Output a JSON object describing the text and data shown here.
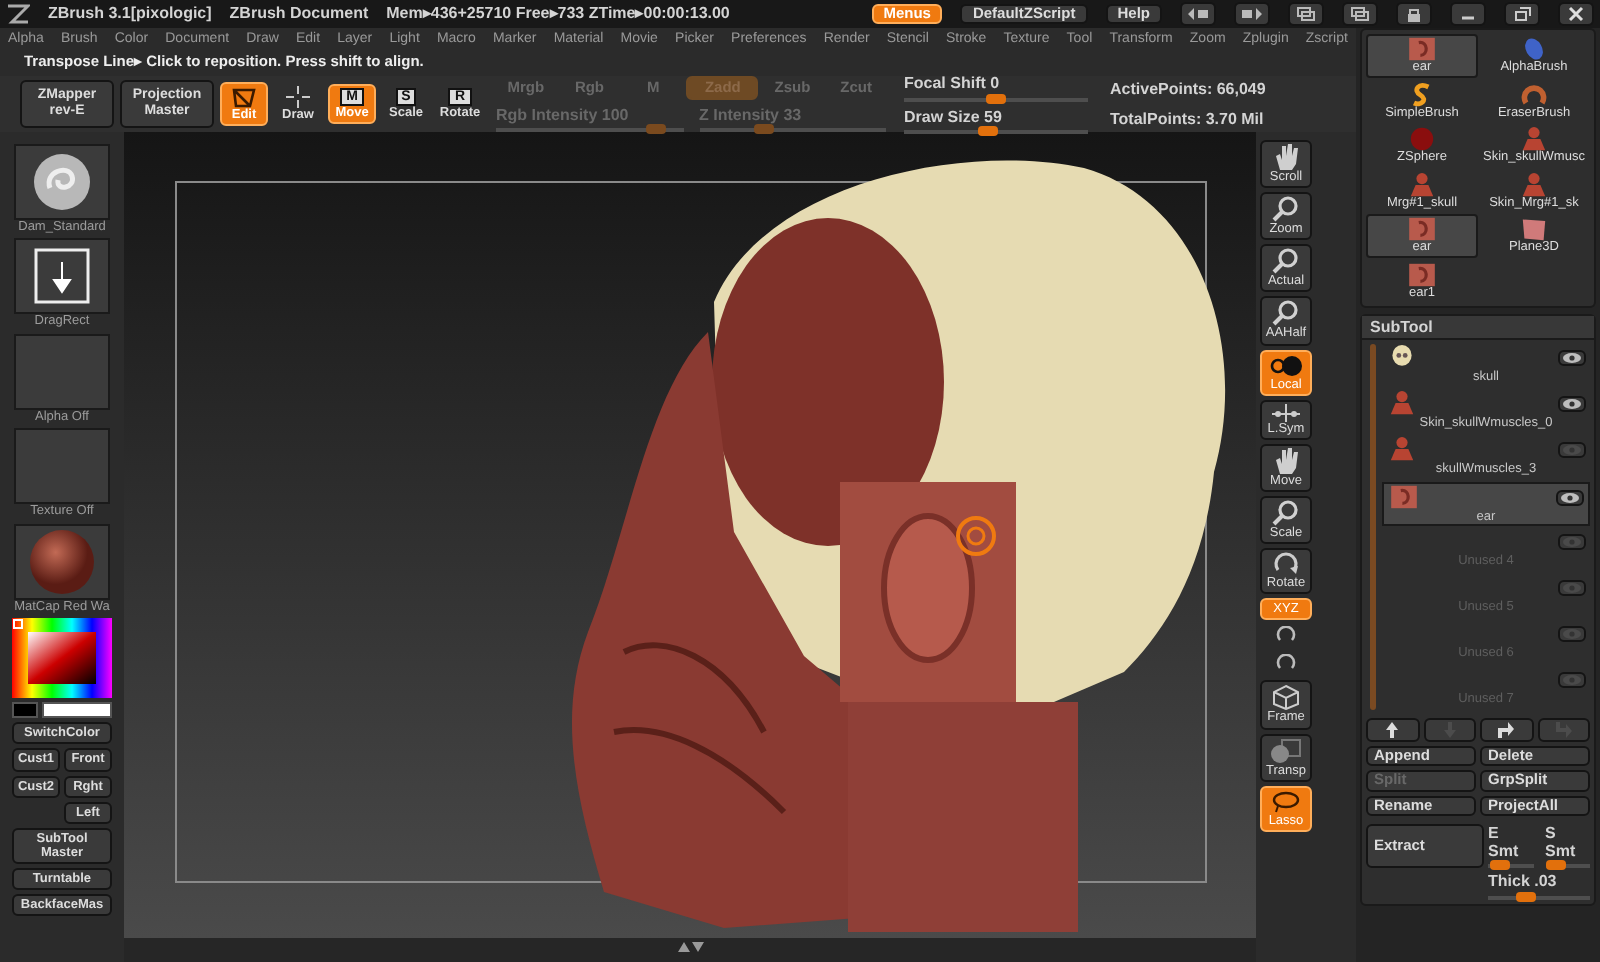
{
  "title_bar": {
    "app": "ZBrush 3.1[pixologic]",
    "document": "ZBrush Document",
    "stats": "Mem▸436+25710 Free▸733 ZTime▸00:00:13.00",
    "buttons": [
      {
        "label": "Menus",
        "selected": true
      },
      {
        "label": "DefaultZScript",
        "selected": false
      },
      {
        "label": "Help",
        "selected": false
      }
    ]
  },
  "menu_bar": [
    "Alpha",
    "Brush",
    "Color",
    "Document",
    "Draw",
    "Edit",
    "Layer",
    "Light",
    "Macro",
    "Marker",
    "Material",
    "Movie",
    "Picker",
    "Preferences",
    "Render",
    "Stencil",
    "Stroke",
    "Texture",
    "Tool",
    "Transform",
    "Zoom",
    "Zplugin",
    "Zscript"
  ],
  "notice": "Transpose Line▸ Click to reposition. Press shift to align.",
  "toolbar": {
    "buttons": [
      {
        "label": "ZMapper",
        "sublabel": "rev-E"
      },
      {
        "label": "Projection",
        "sublabel": "Master"
      }
    ],
    "tools": [
      {
        "kind": "edit",
        "label": "Edit",
        "on": true
      },
      {
        "kind": "draw",
        "label": "Draw",
        "on": false
      },
      {
        "kind": "move",
        "label": "Move",
        "letter": "M",
        "on": true
      },
      {
        "kind": "scale",
        "label": "Scale",
        "letter": "S",
        "on": false
      },
      {
        "kind": "rotate",
        "label": "Rotate",
        "letter": "R",
        "on": false
      }
    ],
    "channels": [
      {
        "label": "Mrgb",
        "on": false,
        "disabled": true
      },
      {
        "label": "Rgb",
        "on": false,
        "disabled": true
      },
      {
        "label": "M",
        "on": false,
        "disabled": true
      },
      {
        "label": "Zadd",
        "on": true,
        "disabled": true
      },
      {
        "label": "Zsub",
        "on": false,
        "disabled": true
      },
      {
        "label": "Zcut",
        "on": false,
        "disabled": true
      }
    ],
    "intensity_sliders": [
      {
        "label": "Rgb Intensity",
        "value": "100",
        "level": 0.9,
        "disabled": true
      },
      {
        "label": "Z Intensity",
        "value": "33",
        "level": 0.33,
        "disabled": true
      }
    ],
    "draw_sliders": [
      {
        "label": "Focal Shift",
        "value": "0",
        "level": 0.5
      },
      {
        "label": "Draw Size",
        "value": "59",
        "level": 0.45
      }
    ],
    "stats": [
      "ActivePoints: 66,049",
      "TotalPoints: 3.70 Mil"
    ]
  },
  "left_shelf": {
    "thumbs": [
      {
        "kind": "brush",
        "label": "Dam_Standard"
      },
      {
        "kind": "stroke",
        "label": "DragRect"
      },
      {
        "kind": "alpha",
        "label": "Alpha Off"
      },
      {
        "kind": "texture",
        "label": "Texture Off"
      },
      {
        "kind": "material",
        "label": "MatCap Red Wa"
      }
    ],
    "swatches": [
      {
        "color": "#000000"
      },
      {
        "color": "#ffffff"
      }
    ],
    "button_rows": [
      [
        "SwitchColor"
      ],
      [
        "Cust1",
        "Front"
      ],
      [
        "Cust2",
        "Rght"
      ],
      [
        "Left"
      ],
      [
        "SubTool Master"
      ],
      [
        "Turntable"
      ],
      [
        "BackfaceMas"
      ]
    ]
  },
  "right_shelf": [
    {
      "kind": "scroll",
      "label": "Scroll",
      "on": false
    },
    {
      "kind": "zoom",
      "label": "Zoom",
      "on": false
    },
    {
      "kind": "actual",
      "label": "Actual",
      "on": false
    },
    {
      "kind": "aahalf",
      "label": "AAHalf",
      "on": false
    },
    {
      "kind": "local",
      "label": "Local",
      "on": true
    },
    {
      "kind": "lsym",
      "label": "L.Sym",
      "on": false
    },
    {
      "kind": "move",
      "label": "Move",
      "on": false
    },
    {
      "kind": "scale",
      "label": "Scale",
      "on": false
    },
    {
      "kind": "rotate",
      "label": "Rotate",
      "on": false
    },
    {
      "kind": "xyz",
      "label": "XYZ",
      "on": true
    },
    {
      "kind": "rot-y"
    },
    {
      "kind": "rot-z"
    },
    {
      "kind": "frame",
      "label": "Frame",
      "on": false
    },
    {
      "kind": "transp",
      "label": "Transp",
      "on": false
    },
    {
      "kind": "lasso",
      "label": "Lasso",
      "on": true
    }
  ],
  "tool_palette": [
    {
      "kind": "ear",
      "label": "ear",
      "selected": true
    },
    {
      "kind": "alpha",
      "label": "AlphaBrush",
      "selected": false
    },
    {
      "kind": "simple",
      "label": "SimpleBrush",
      "selected": false
    },
    {
      "kind": "eraser",
      "label": "EraserBrush",
      "selected": false
    },
    {
      "kind": "zsphere",
      "label": "ZSphere",
      "selected": false
    },
    {
      "kind": "figure",
      "label": "Skin_skullWmusc",
      "selected": false
    },
    {
      "kind": "figure",
      "label": "Mrg#1_skull",
      "selected": false
    },
    {
      "kind": "figure",
      "label": "Skin_Mrg#1_sk",
      "selected": false
    },
    {
      "kind": "ear",
      "label": "ear",
      "selected": true
    },
    {
      "kind": "plane",
      "label": "Plane3D",
      "selected": false
    },
    {
      "kind": "ear",
      "label": "ear1",
      "selected": false
    }
  ],
  "subtool": {
    "title": "SubTool",
    "items": [
      {
        "kind": "skull",
        "label": "skull",
        "selected": false,
        "visible": true
      },
      {
        "kind": "figure",
        "label": "Skin_skullWmuscles_0",
        "selected": false,
        "visible": true
      },
      {
        "kind": "figure",
        "label": "skullWmuscles_3",
        "selected": false,
        "visible": false
      },
      {
        "kind": "ear",
        "label": "ear",
        "selected": true,
        "visible": true
      },
      {
        "kind": "empty",
        "label": "Unused 4",
        "selected": false,
        "visible": false
      },
      {
        "kind": "empty",
        "label": "Unused 5",
        "selected": false,
        "visible": false
      },
      {
        "kind": "empty",
        "label": "Unused 6",
        "selected": false,
        "visible": false
      },
      {
        "kind": "empty",
        "label": "Unused 7",
        "selected": false,
        "visible": false
      }
    ],
    "arrows": [
      {
        "kind": "up",
        "disabled": false
      },
      {
        "kind": "down",
        "disabled": true
      },
      {
        "kind": "turn",
        "disabled": false
      },
      {
        "kind": "turn-down",
        "disabled": true
      }
    ],
    "buttons": [
      {
        "label": "Append",
        "disabled": false
      },
      {
        "label": "Delete",
        "disabled": false
      },
      {
        "label": "Split",
        "disabled": true
      },
      {
        "label": "GrpSplit",
        "disabled": false
      },
      {
        "label": "Rename",
        "disabled": false
      },
      {
        "label": "ProjectAll",
        "disabled": false
      }
    ],
    "extract": "Extract",
    "sliders": [
      {
        "label": "E",
        "value": "Smt",
        "level": 0.05
      },
      {
        "label": "S",
        "value": "Smt",
        "level": 0.05
      },
      {
        "label": "Thick",
        "value": ".03",
        "level": 0.35
      }
    ]
  }
}
